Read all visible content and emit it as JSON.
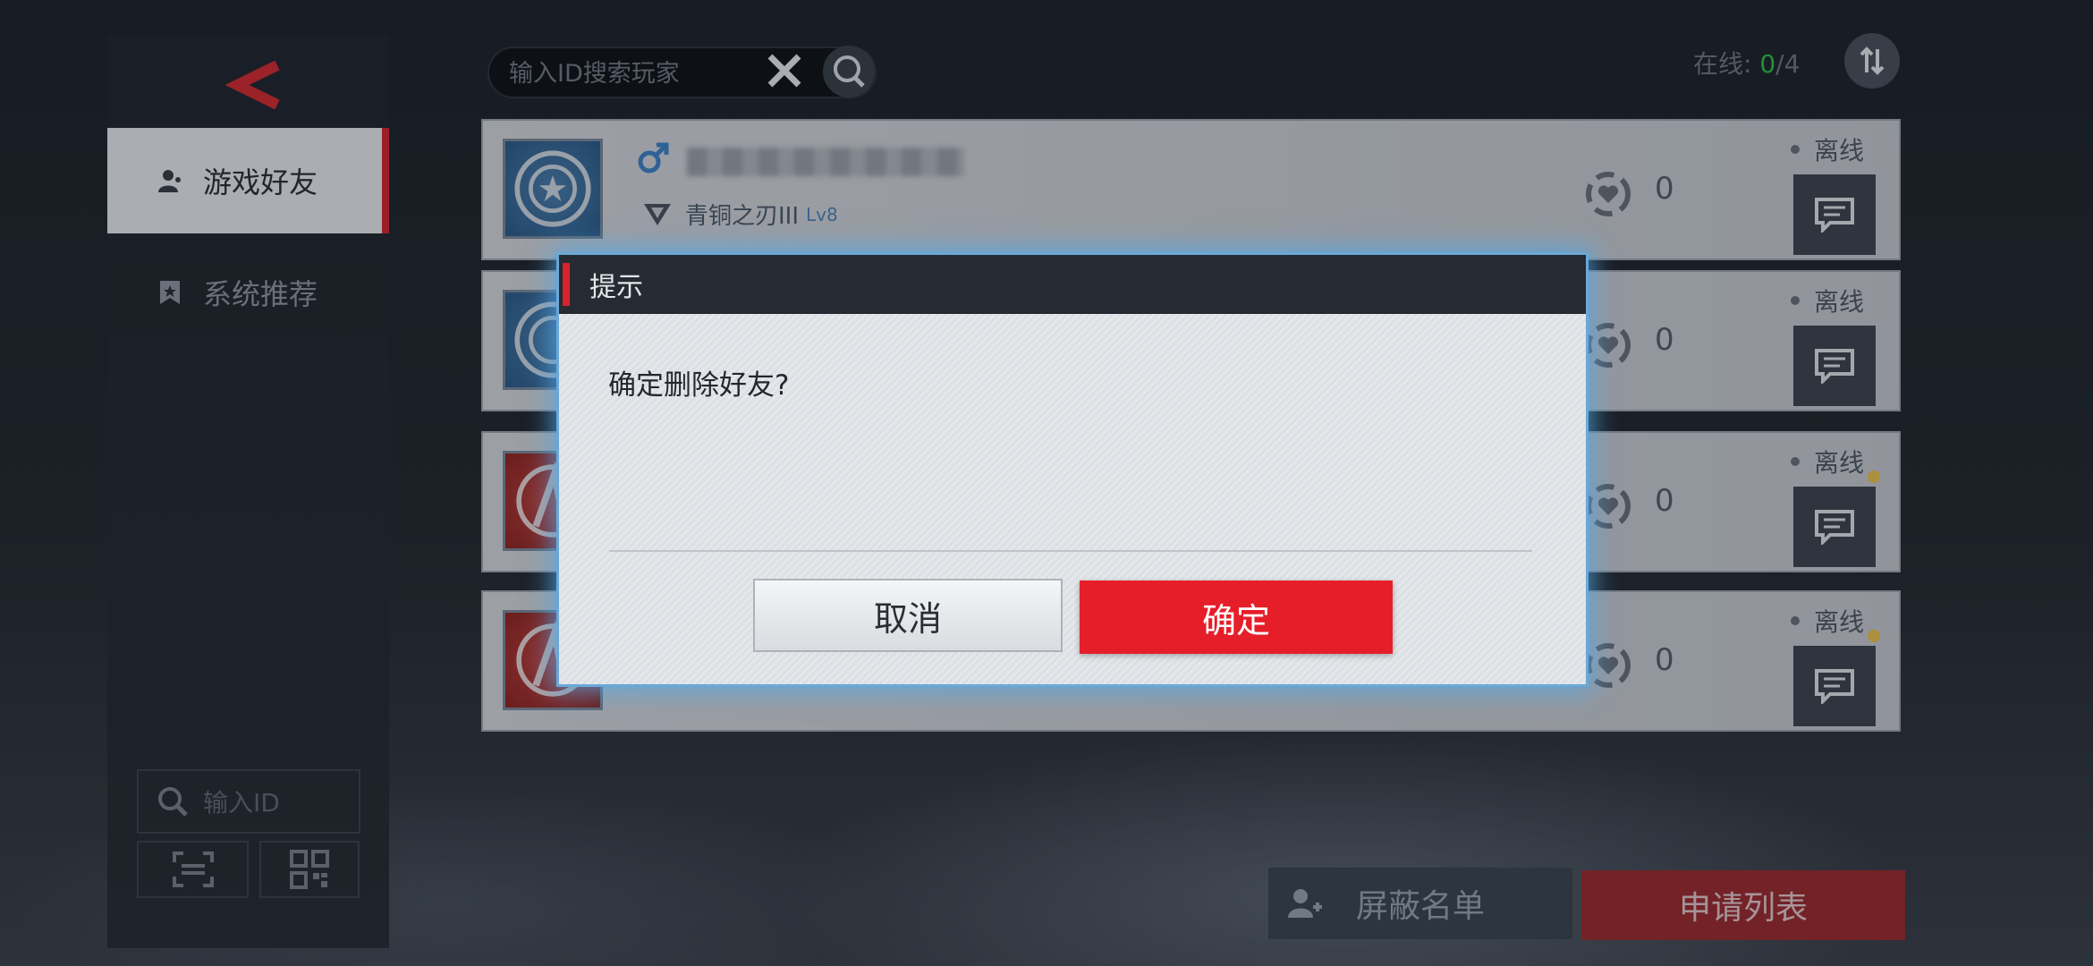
{
  "search": {
    "placeholder": "输入ID搜索玩家"
  },
  "online": {
    "label": "在线: ",
    "current": "0",
    "sep": "/",
    "total": "4"
  },
  "nav": {
    "tabs": [
      {
        "label": "游戏好友",
        "active": true
      },
      {
        "label": "系统推荐",
        "active": false
      }
    ]
  },
  "left_search": {
    "placeholder": "输入ID"
  },
  "friends": [
    {
      "avatar": "captain-shield",
      "gender": "male",
      "rank": "青铜之刃III",
      "level": "Lv8",
      "intimacy": "0",
      "status": "离线",
      "new_message": false
    },
    {
      "avatar": "captain-shield",
      "intimacy": "0",
      "status": "离线",
      "new_message": false
    },
    {
      "avatar": "avengers-logo",
      "intimacy": "0",
      "status": "离线",
      "new_message": true
    },
    {
      "avatar": "avengers-logo",
      "intimacy": "0",
      "status": "离线",
      "new_message": true
    }
  ],
  "bottom": {
    "block_list": "屏蔽名单",
    "apply_list": "申请列表"
  },
  "dialog": {
    "title": "提示",
    "message": "确定删除好友?",
    "cancel": "取消",
    "confirm": "确定"
  },
  "colors": {
    "accent_red": "#e61e2a",
    "online_green": "#30c04a",
    "dialog_glow": "#50aaeb"
  }
}
